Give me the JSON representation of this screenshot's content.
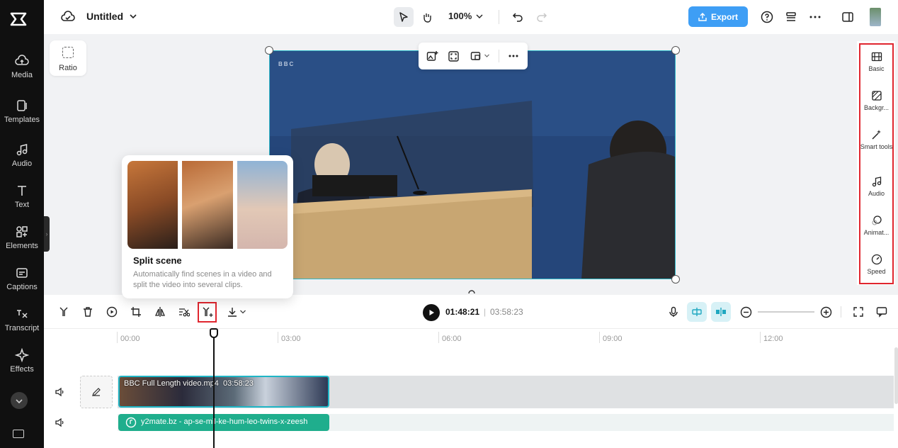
{
  "app": {
    "project_title": "Untitled",
    "zoom": "100%",
    "export_label": "Export"
  },
  "left_sidebar": {
    "items": [
      {
        "label": "Media",
        "icon": "cloud-upload-icon"
      },
      {
        "label": "Templates",
        "icon": "templates-icon"
      },
      {
        "label": "Audio",
        "icon": "music-note-icon"
      },
      {
        "label": "Text",
        "icon": "text-icon"
      },
      {
        "label": "Elements",
        "icon": "elements-icon"
      },
      {
        "label": "Captions",
        "icon": "captions-icon"
      },
      {
        "label": "Transcript",
        "icon": "transcript-icon"
      },
      {
        "label": "Effects",
        "icon": "sparkle-icon"
      }
    ]
  },
  "canvas": {
    "ratio_label": "Ratio",
    "video_watermark": "BBC"
  },
  "right_panel": {
    "items": [
      {
        "label": "Basic",
        "icon": "film-icon"
      },
      {
        "label": "Backgr...",
        "icon": "background-icon"
      },
      {
        "label": "Smart tools",
        "icon": "magic-wand-icon"
      },
      {
        "label": "Audio",
        "icon": "music-note-icon"
      },
      {
        "label": "Animat...",
        "icon": "animation-icon"
      },
      {
        "label": "Speed",
        "icon": "speedometer-icon"
      }
    ]
  },
  "timeline": {
    "current_time": "01:48:21",
    "separator": "|",
    "total_time": "03:58:23",
    "ruler": [
      "00:00",
      "03:00",
      "06:00",
      "09:00",
      "12:00"
    ],
    "video_clip": {
      "name": "BBC Full Length video.mp4",
      "duration": "03:58:23"
    },
    "audio_clip": {
      "name": "y2mate.bz - ap-se-mil-ke-hum-leo-twins-x-zeesh"
    }
  },
  "tooltip": {
    "title": "Split scene",
    "description": "Automatically find scenes in a video and split the video into several clips."
  },
  "colors": {
    "accent": "#3e9ef5",
    "highlight": "#e0262f",
    "clip_border": "#1fb6c6",
    "audio_clip": "#1fae8d",
    "sidebar": "#101010"
  }
}
